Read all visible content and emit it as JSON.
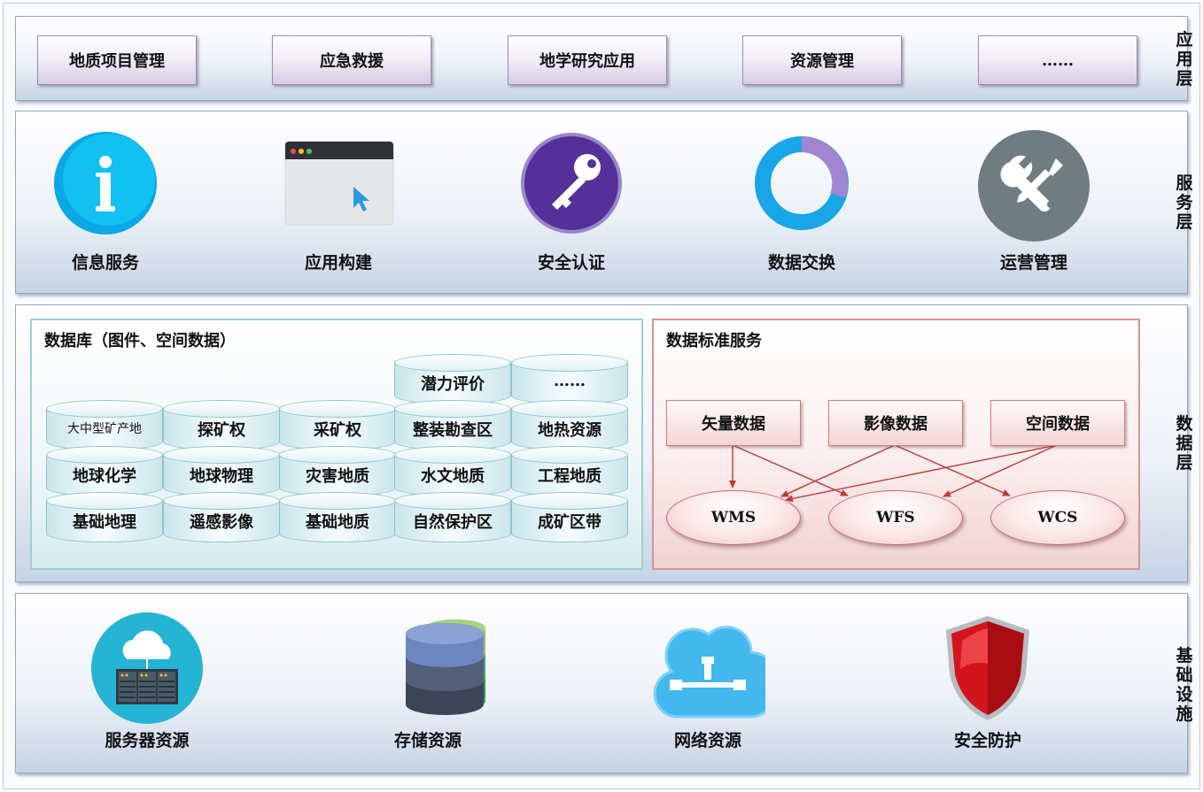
{
  "layers": {
    "app_label": "应\n用\n层",
    "service_label": "服\n务\n层",
    "data_label": "数\n据\n层",
    "infra_label": "基\n础\n设\n施"
  },
  "app_layer": {
    "items": [
      "地质项目管理",
      "应急救援",
      "地学研究应用",
      "资源管理",
      "……"
    ]
  },
  "service_layer": {
    "items": [
      {
        "label": "信息服务",
        "icon": "info-icon"
      },
      {
        "label": "应用构建",
        "icon": "browser-window-icon"
      },
      {
        "label": "安全认证",
        "icon": "key-icon"
      },
      {
        "label": "数据交换",
        "icon": "donut-ring-icon"
      },
      {
        "label": "运营管理",
        "icon": "wrench-screwdriver-icon"
      }
    ]
  },
  "database": {
    "title": "数据库（图件、空间数据）",
    "cylinders": [
      [
        "大中型矿产地",
        "地球化学",
        "基础地理"
      ],
      [
        "探矿权",
        "地球物理",
        "遥感影像"
      ],
      [
        "采矿权",
        "灾害地质",
        "基础地质"
      ],
      [
        "潜力评价",
        "整装勘查区",
        "水文地质",
        "自然保护区"
      ],
      [
        "……",
        "地热资源",
        "工程地质",
        "成矿区带"
      ]
    ]
  },
  "standard_service": {
    "title": "数据标准服务",
    "sources": [
      "矢量数据",
      "影像数据",
      "空间数据"
    ],
    "services": [
      "WMS",
      "WFS",
      "WCS"
    ]
  },
  "infra_layer": {
    "items": [
      {
        "label": "服务器资源",
        "icon": "cloud-server-icon"
      },
      {
        "label": "存储资源",
        "icon": "database-stack-icon"
      },
      {
        "label": "网络资源",
        "icon": "cloud-network-icon"
      },
      {
        "label": "安全防护",
        "icon": "shield-icon"
      }
    ]
  },
  "colors": {
    "app_button": "#e9e1f1",
    "info_icon": "#11b9ee",
    "key_icon": "#5b2f97",
    "donut_main": "#16a5e8",
    "donut_accent": "#a184d2",
    "tool_icon": "#6f7c82",
    "arrow": "#c0393b",
    "shield": "#c81219"
  }
}
